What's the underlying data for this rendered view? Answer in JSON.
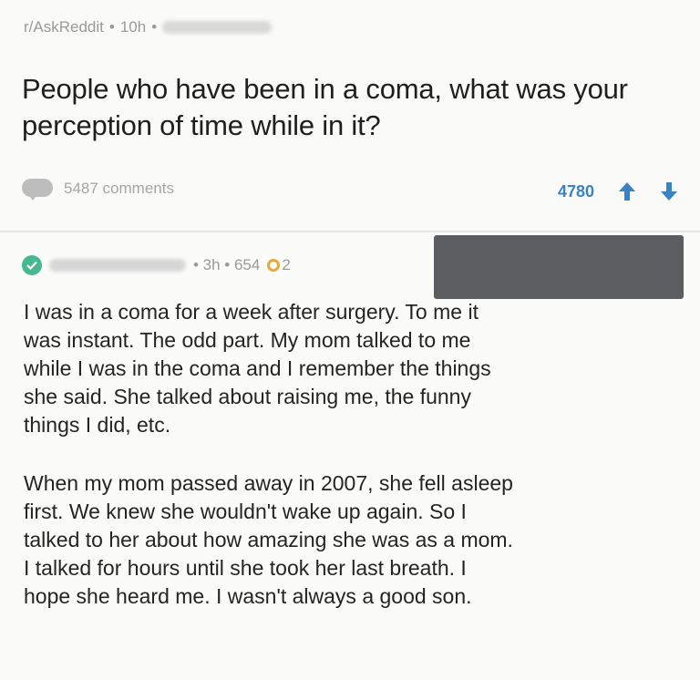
{
  "post": {
    "subreddit": "r/AskReddit",
    "separator": "•",
    "age": "10h",
    "title": "People who have been in a coma, what was your perception of time while in it?",
    "comments_label": "5487 comments",
    "score": "4780"
  },
  "comment": {
    "meta_time": "• 3h • 654",
    "award_count": "2",
    "paragraphs": [
      "I was in a coma for a week after surgery.  To me it\nwas instant.  The odd part.  My mom talked to me\nwhile I was in the coma and I remember the things\nshe said.  She talked about raising me, the funny\nthings I did, etc.",
      "When my mom passed away in 2007, she fell asleep\nfirst.  We knew she wouldn't wake up again.  So I\ntalked to her about how amazing she was as a mom.\nI talked for hours until she took her last breath.  I\nhope she heard me. I wasn't always a good son."
    ]
  },
  "colors": {
    "vote_blue": "#3b82c4",
    "verified_green": "#46b98f",
    "award_gold": "#e7a73a",
    "redaction_gray": "#5b5d60"
  }
}
